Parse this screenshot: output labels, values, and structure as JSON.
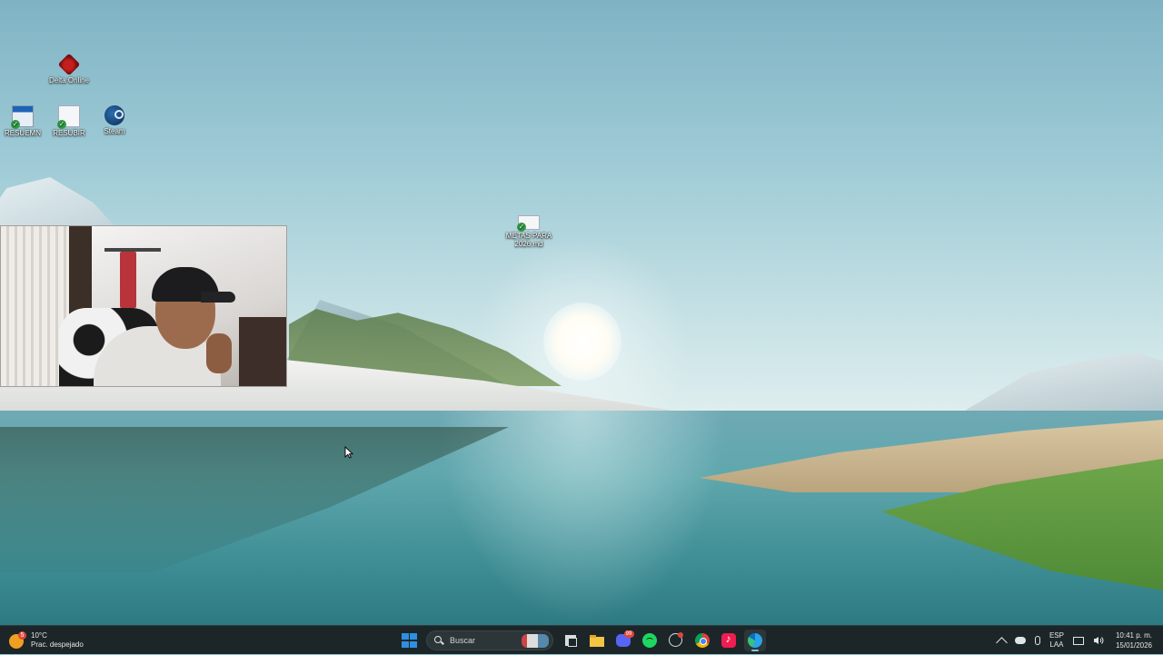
{
  "desktop": {
    "icons": [
      {
        "label": "Delta Online",
        "icon": "delta-online-icon"
      },
      {
        "label": "RESUEMN",
        "icon": "spreadsheet-file-icon"
      },
      {
        "label": "RESUBIR",
        "icon": "text-file-icon"
      },
      {
        "label": "Steam",
        "icon": "steam-icon"
      },
      {
        "label": "METAS PARA 2026.md",
        "icon": "markdown-file-icon"
      }
    ]
  },
  "webcam": {
    "icon": "webcam-overlay"
  },
  "taskbar": {
    "weather": {
      "temperature": "10°C",
      "condition": "Prac. despejado",
      "badge": "5"
    },
    "search": {
      "placeholder": "Buscar"
    },
    "apps": [
      {
        "name": "start",
        "icon": "windows-start-icon"
      },
      {
        "name": "task-view",
        "icon": "task-view-icon"
      },
      {
        "name": "file-explorer",
        "icon": "folder-icon"
      },
      {
        "name": "discord",
        "icon": "discord-icon",
        "badge": "99"
      },
      {
        "name": "spotify",
        "icon": "spotify-icon"
      },
      {
        "name": "clock-app",
        "icon": "clock-icon"
      },
      {
        "name": "chrome",
        "icon": "chrome-icon"
      },
      {
        "name": "tiktok",
        "icon": "tiktok-icon"
      },
      {
        "name": "edge",
        "icon": "edge-icon"
      }
    ],
    "tray": {
      "language_top": "ESP",
      "language_bottom": "LAA",
      "time": "10:41 p. m.",
      "date": "15/01/2026"
    }
  },
  "colors": {
    "taskbar_bg": "#1c2629",
    "accent": "#2f8fe0"
  }
}
